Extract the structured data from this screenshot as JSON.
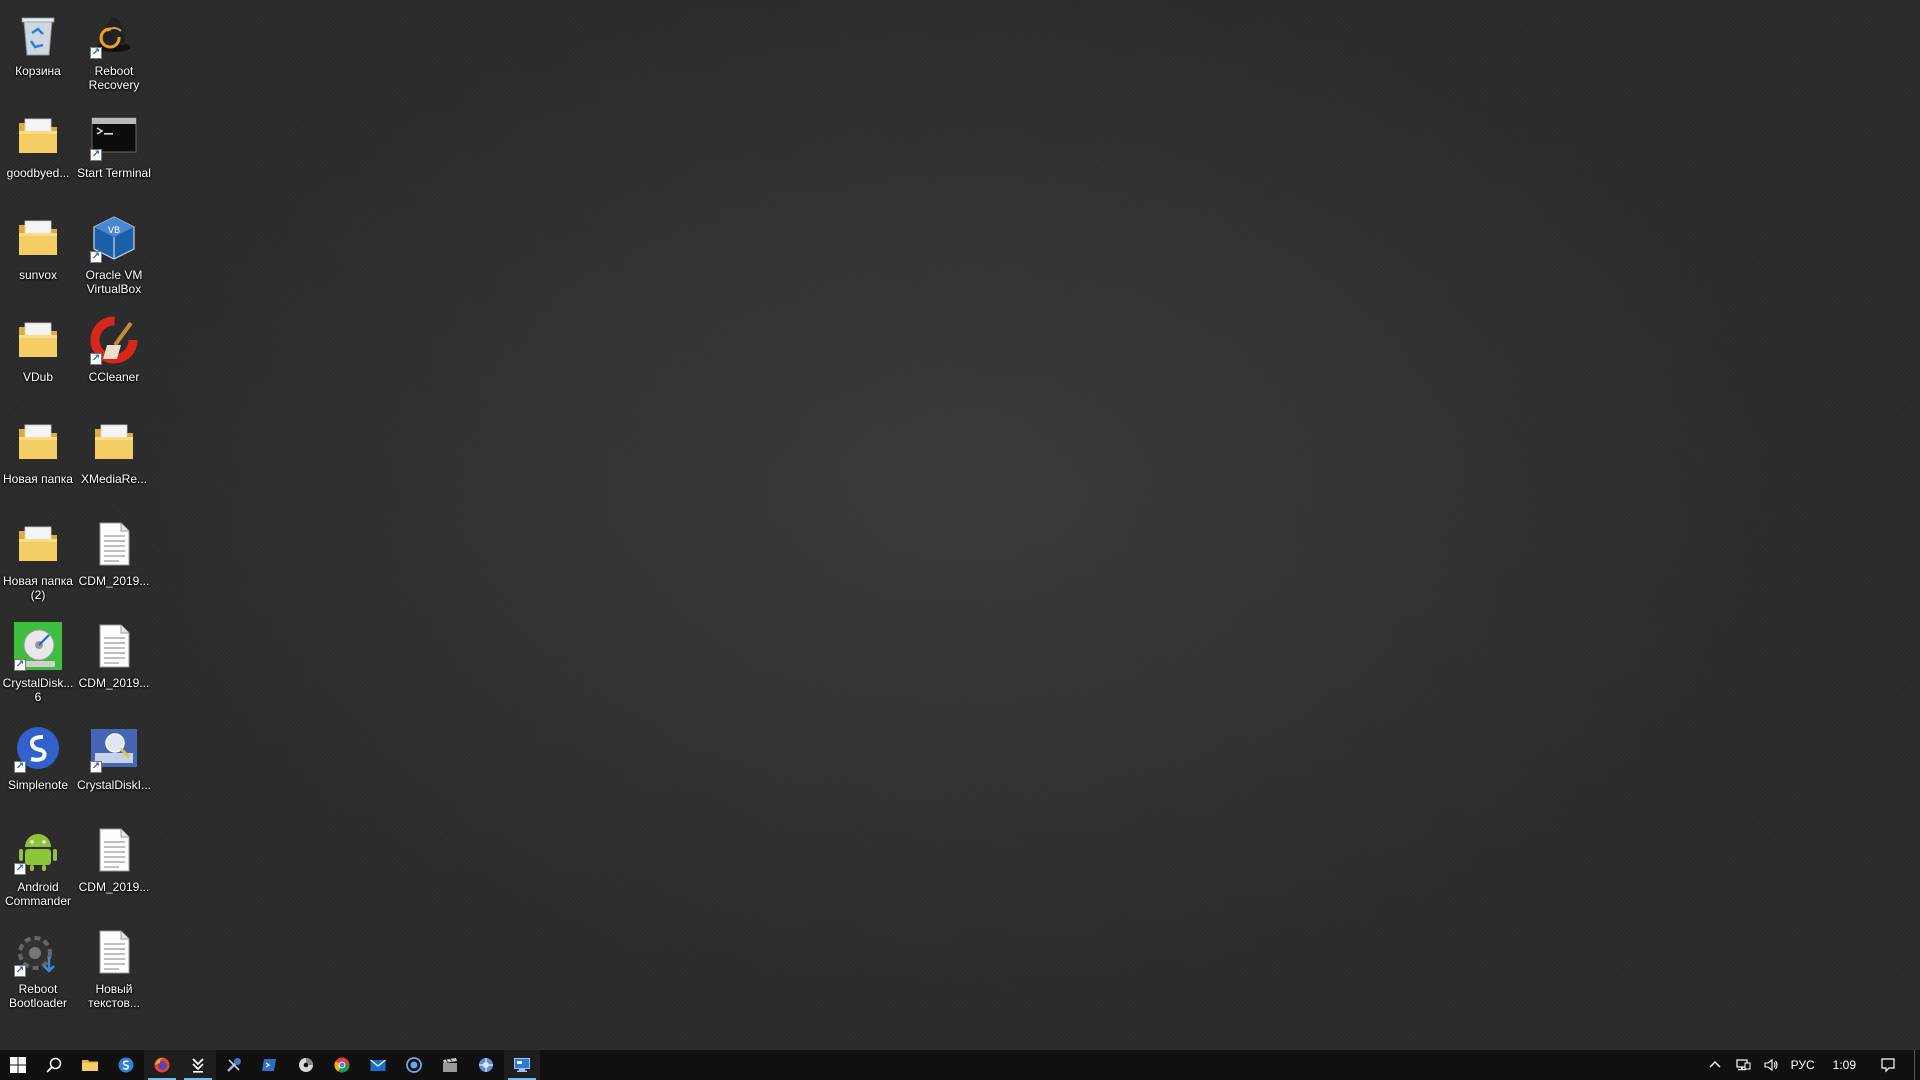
{
  "desktop": {
    "icons": [
      {
        "label": "Корзина",
        "icon": "recycle-bin-icon"
      },
      {
        "label": "Reboot Recovery",
        "icon": "reboot-recovery-icon"
      },
      {
        "label": "goodbyed...",
        "icon": "folder-icon"
      },
      {
        "label": "Start Terminal",
        "icon": "terminal-icon"
      },
      {
        "label": "sunvox",
        "icon": "folder-icon"
      },
      {
        "label": "Oracle VM VirtualBox",
        "icon": "virtualbox-icon"
      },
      {
        "label": "VDub",
        "icon": "folder-icon"
      },
      {
        "label": "CCleaner",
        "icon": "ccleaner-icon"
      },
      {
        "label": "Новая папка",
        "icon": "folder-icon"
      },
      {
        "label": "XMediaRe...",
        "icon": "folder-icon"
      },
      {
        "label": "Новая папка (2)",
        "icon": "folder-icon"
      },
      {
        "label": "CDM_2019...",
        "icon": "text-file-icon"
      },
      {
        "label": "CrystalDisk... 6",
        "icon": "crystaldiskmark-icon"
      },
      {
        "label": "CDM_2019...",
        "icon": "text-file-icon"
      },
      {
        "label": "Simplenote",
        "icon": "simplenote-icon"
      },
      {
        "label": "CrystalDiskI...",
        "icon": "crystaldiskinfo-icon"
      },
      {
        "label": "Android Commander",
        "icon": "android-icon"
      },
      {
        "label": "CDM_2019...",
        "icon": "text-file-icon"
      },
      {
        "label": "Reboot Bootloader",
        "icon": "reboot-bootloader-icon"
      },
      {
        "label": "Новый текстов...",
        "icon": "text-file-icon"
      }
    ]
  },
  "taskbar": {
    "start_icon": "windows-start-icon",
    "search_icon": "search-icon",
    "apps": [
      {
        "name": "file-explorer",
        "icon": "folder-icon",
        "active": false
      },
      {
        "name": "skype",
        "icon": "skype-icon",
        "active": false
      },
      {
        "name": "firefox",
        "icon": "firefox-icon",
        "active": true
      },
      {
        "name": "app-arrows",
        "icon": "download-arrows-icon",
        "active": true
      },
      {
        "name": "app-tools",
        "icon": "tools-icon",
        "active": false
      },
      {
        "name": "app-script",
        "icon": "script-icon",
        "active": false
      },
      {
        "name": "app-disc",
        "icon": "disc-icon",
        "active": false
      },
      {
        "name": "chrome",
        "icon": "chrome-icon",
        "active": false
      },
      {
        "name": "app-mail",
        "icon": "mail-icon",
        "active": false
      },
      {
        "name": "app-circle",
        "icon": "circle-app-icon",
        "active": false
      },
      {
        "name": "app-clapper",
        "icon": "clapper-icon",
        "active": false
      },
      {
        "name": "app-network",
        "icon": "network-tool-icon",
        "active": false
      },
      {
        "name": "app-monitor",
        "icon": "monitor-icon",
        "active": true
      }
    ],
    "tray": {
      "language": "РУС",
      "time": "1:09"
    }
  },
  "colors": {
    "taskbar_bg": "#101010",
    "active_underline": "#76b9ed",
    "folder": "#f3cd63"
  }
}
